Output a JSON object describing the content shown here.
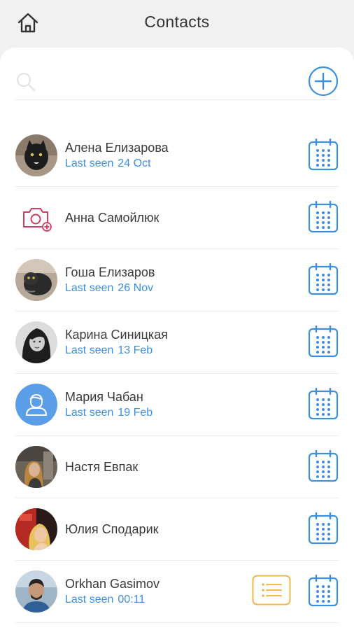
{
  "header": {
    "title": "Contacts",
    "home_icon": "home-icon"
  },
  "search": {
    "placeholder": "",
    "value": "",
    "icon": "search-icon"
  },
  "add_button": {
    "icon": "plus-circle-icon",
    "color": "#3d8fe0"
  },
  "colors": {
    "accent": "#3d8fe0",
    "notes": "#f2b84b",
    "camera": "#d63a5e"
  },
  "contacts": [
    {
      "name": "Алена Елизарова",
      "seen_label": "Last seen",
      "seen_value": "24 Oct",
      "avatar": "photo"
    },
    {
      "name": "Анна Самойлюк",
      "seen_label": "",
      "seen_value": "",
      "avatar": "camera-icon"
    },
    {
      "name": "Гоша Елизаров",
      "seen_label": "Last seen",
      "seen_value": "26 Nov",
      "avatar": "photo"
    },
    {
      "name": "Карина Синицкая",
      "seen_label": "Last seen",
      "seen_value": "13 Feb",
      "avatar": "photo"
    },
    {
      "name": "Мария Чабан",
      "seen_label": "Last seen",
      "seen_value": "19 Feb",
      "avatar": "person-icon"
    },
    {
      "name": "Настя Евпак",
      "seen_label": "",
      "seen_value": "",
      "avatar": "photo"
    },
    {
      "name": "Юлия Сподарик",
      "seen_label": "",
      "seen_value": "",
      "avatar": "photo"
    },
    {
      "name": "Orkhan Gasimov",
      "seen_label": "Last seen",
      "seen_value": "00:11",
      "avatar": "photo",
      "has_notes": true
    }
  ]
}
